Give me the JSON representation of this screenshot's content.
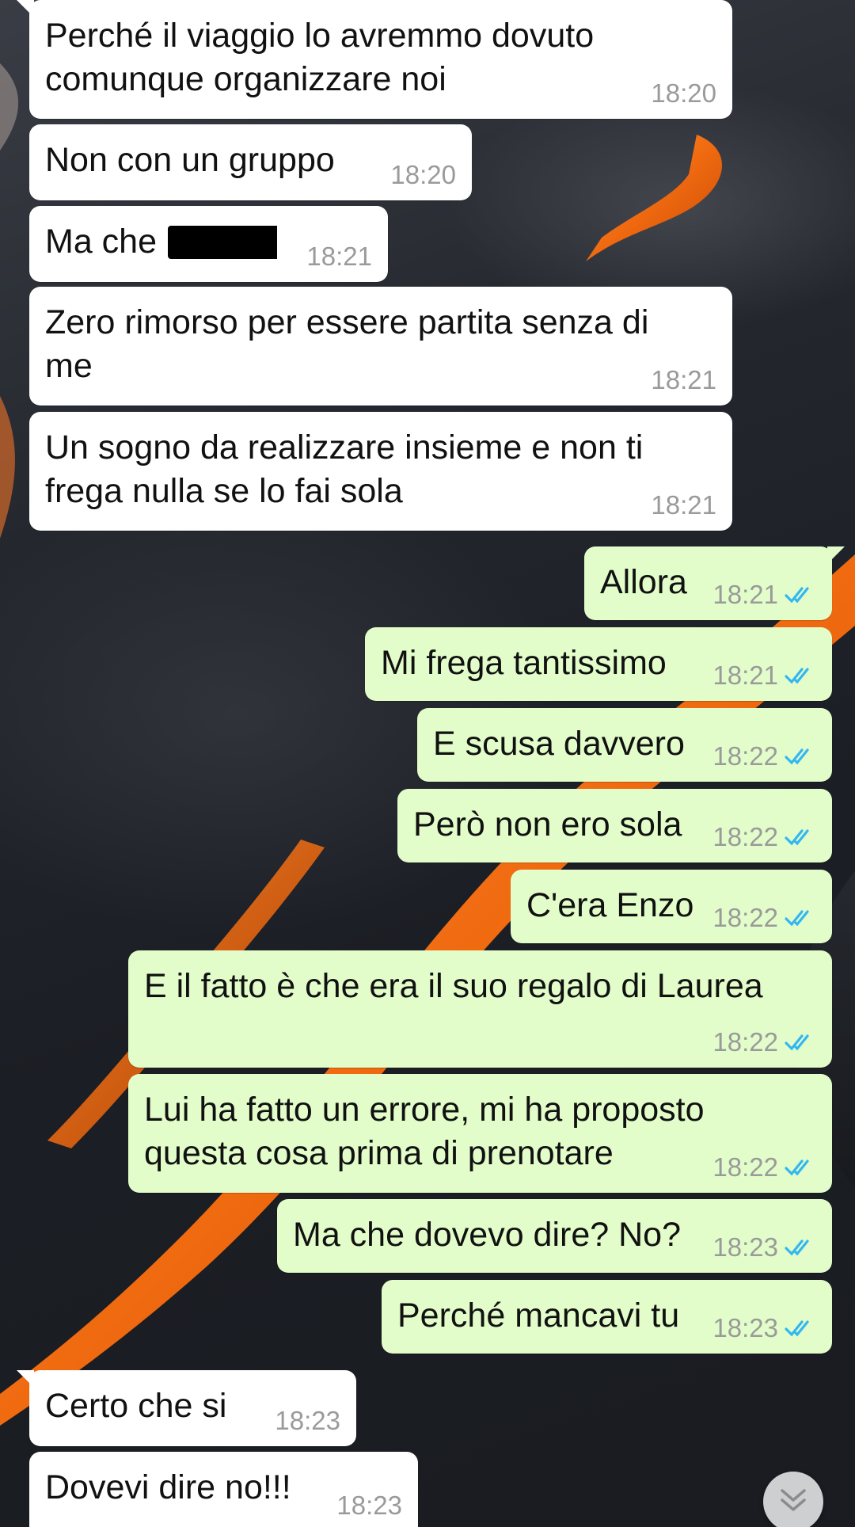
{
  "colors": {
    "incoming_bubble": "#ffffff",
    "outgoing_bubble": "#e2fdca",
    "read_ticks": "#34b7f1",
    "timestamp": "#9a9a9a"
  },
  "messages": [
    {
      "direction": "in",
      "text": "Perché il viaggio lo avremmo dovuto\ncomunque organizzare noi",
      "time": "18:20"
    },
    {
      "direction": "in",
      "text": "Non con un gruppo",
      "time": "18:20"
    },
    {
      "direction": "in",
      "text": "Ma che",
      "time": "18:21",
      "redacted": true
    },
    {
      "direction": "in",
      "text": "Zero rimorso per essere partita senza di\nme",
      "time": "18:21"
    },
    {
      "direction": "in",
      "text": "Un sogno da realizzare insieme e non ti\nfrega nulla se lo fai sola",
      "time": "18:21"
    },
    {
      "direction": "out",
      "text": "Allora",
      "time": "18:21",
      "status": "read"
    },
    {
      "direction": "out",
      "text": "Mi frega tantissimo",
      "time": "18:21",
      "status": "read"
    },
    {
      "direction": "out",
      "text": "E scusa davvero",
      "time": "18:22",
      "status": "read"
    },
    {
      "direction": "out",
      "text": "Però non ero sola",
      "time": "18:22",
      "status": "read"
    },
    {
      "direction": "out",
      "text": "C'era Enzo",
      "time": "18:22",
      "status": "read"
    },
    {
      "direction": "out",
      "text": "E il fatto è che era il suo regalo di Laurea",
      "time": "18:22",
      "status": "read"
    },
    {
      "direction": "out",
      "text": "Lui ha fatto un errore, mi ha proposto\nquesta cosa prima di prenotare",
      "time": "18:22",
      "status": "read"
    },
    {
      "direction": "out",
      "text": "Ma che dovevo dire? No?",
      "time": "18:23",
      "status": "read"
    },
    {
      "direction": "out",
      "text": "Perché mancavi tu",
      "time": "18:23",
      "status": "read"
    },
    {
      "direction": "in",
      "text": "Certo che si",
      "time": "18:23"
    },
    {
      "direction": "in",
      "text": "Dovevi dire no!!!",
      "time": "18:23"
    }
  ],
  "scroll_button": {
    "icon": "double-chevron-down-icon"
  }
}
